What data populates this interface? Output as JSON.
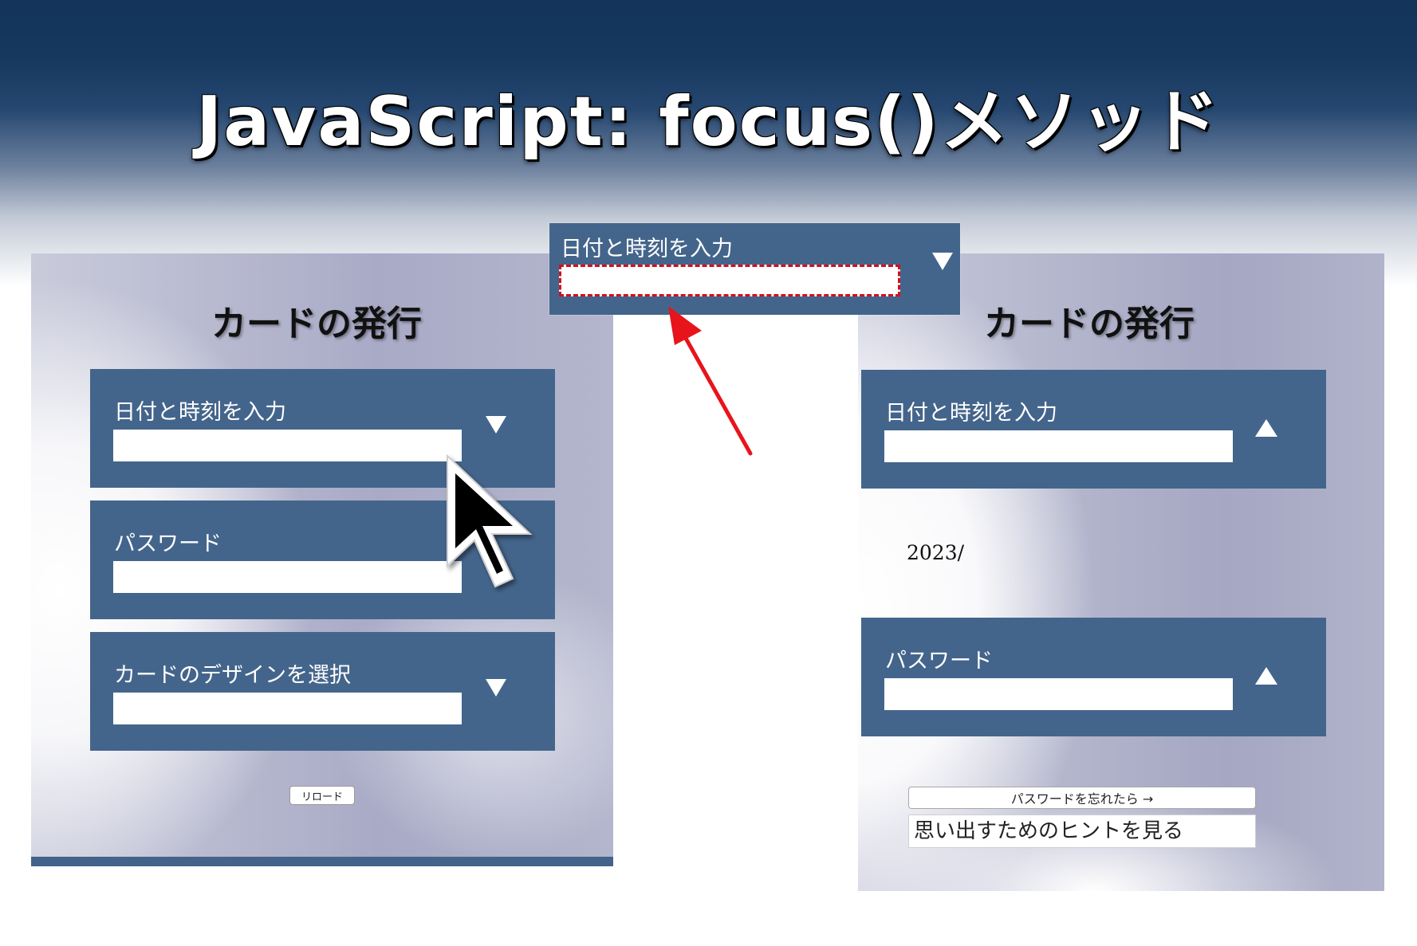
{
  "title": "JavaScript: focus()メソッド",
  "left_form": {
    "heading": "カードの発行",
    "fields": [
      {
        "label": "日付と時刻を入力",
        "value": ""
      },
      {
        "label": "パスワード",
        "value": ""
      },
      {
        "label": "カードのデザインを選択",
        "value": ""
      }
    ],
    "reload_button": "リロード"
  },
  "popup": {
    "label": "日付と時刻を入力",
    "value": ""
  },
  "right_form": {
    "heading": "カードの発行",
    "fields": [
      {
        "label": "日付と時刻を入力",
        "value": ""
      },
      {
        "label": "パスワード",
        "value": ""
      }
    ],
    "date_text": "2023/",
    "forgot_button": "パスワードを忘れたら →",
    "hint_link": "思い出すためのヒントを見る"
  },
  "colors": {
    "field_bg": "#44658b",
    "focus_outline": "#d0101e",
    "annotation_arrow": "#e8141c"
  },
  "icons": [
    "triangle-down-icon",
    "triangle-up-icon",
    "mouse-cursor-icon",
    "arrow-annotation-icon"
  ]
}
